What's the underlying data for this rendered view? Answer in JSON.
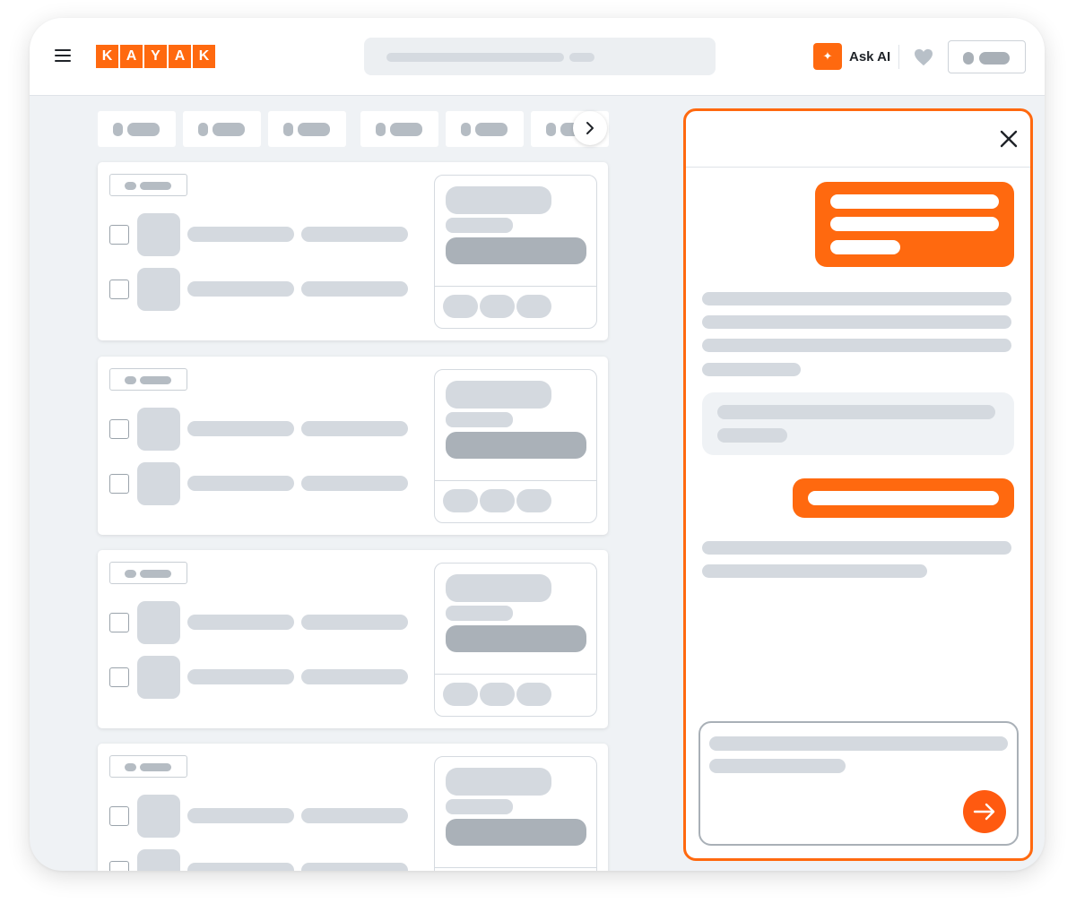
{
  "header": {
    "logo_letters": [
      "K",
      "A",
      "Y",
      "A",
      "K"
    ],
    "ask_ai_label": "Ask AI",
    "icons": {
      "menu": "hamburger-menu-icon",
      "ask_ai": "sparkle-icon",
      "favorites": "heart-icon"
    }
  },
  "filters": {
    "visible_count": 6,
    "next_icon": "chevron-right-icon"
  },
  "results": {
    "card_count": 4
  },
  "ai_panel": {
    "close_icon": "close-icon",
    "send_icon": "arrow-right-icon"
  },
  "colors": {
    "brand": "#ff690f",
    "background": "#eff2f5",
    "placeholder": "#d4d9df",
    "placeholder_dark": "#aab1b8"
  }
}
